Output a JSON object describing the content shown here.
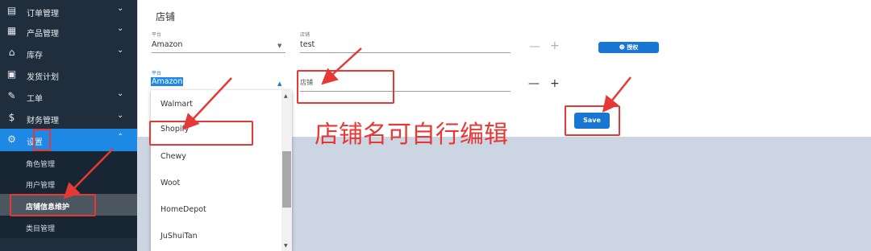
{
  "sidebar": {
    "items": [
      {
        "label": "订单管理",
        "icon": "document-icon"
      },
      {
        "label": "产品管理",
        "icon": "box-icon"
      },
      {
        "label": "库存",
        "icon": "warehouse-icon"
      },
      {
        "label": "发货计划",
        "icon": "truck-icon"
      },
      {
        "label": "工单",
        "icon": "ticket-icon"
      },
      {
        "label": "财务管理",
        "icon": "dollar-icon"
      },
      {
        "label": "设置",
        "icon": "gear-icon"
      }
    ],
    "sub_items": [
      "角色管理",
      "用户管理",
      "店铺信息维护",
      "类目管理"
    ]
  },
  "panel": {
    "title": "店铺",
    "row1": {
      "platform_label": "平台",
      "platform_value": "Amazon",
      "store_label": "店铺",
      "store_value": "test",
      "minus": "—",
      "plus": "+",
      "authorize_label": "授权"
    },
    "row2": {
      "platform_label": "平台",
      "platform_value": "Amazon",
      "store_placeholder": "店铺",
      "minus": "—",
      "plus": "+"
    },
    "save_label": "Save"
  },
  "dropdown": {
    "options": [
      "Walmart",
      "Shopify",
      "Chewy",
      "Woot",
      "HomeDepot",
      "JuShuiTan"
    ]
  },
  "annotation": {
    "text": "店铺名可自行编辑",
    "color": "#e53935"
  },
  "colors": {
    "sidebar_bg": "#1f2d3d",
    "accent": "#1e88e5",
    "button": "#1976d2"
  }
}
